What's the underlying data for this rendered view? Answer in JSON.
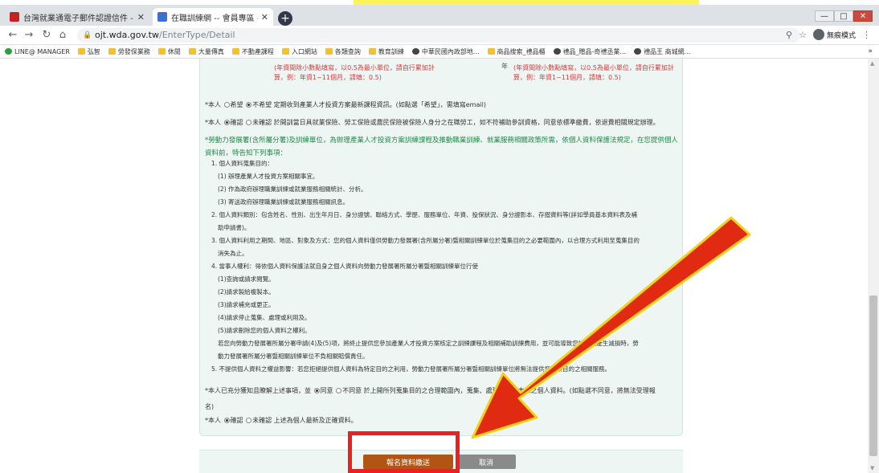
{
  "browser": {
    "tabs": [
      {
        "title": "台灣就業通電子郵件認證信件 - ...",
        "favicon_color": "#c5221f",
        "active": false
      },
      {
        "title": "在職訓練網 -- 會員專區 -- 會員資料",
        "favicon_color": "#3b6fd0",
        "active": true
      }
    ],
    "new_tab": "+",
    "window_controls": [
      "—",
      "□",
      "✕"
    ],
    "address": {
      "host": "ojt.wda.gov.tw",
      "path": "/EnterType/Detail"
    },
    "right_label": "無痕模式",
    "bookmarks": [
      {
        "label": "LINE@ MANAGER",
        "icon": "line-icon"
      },
      {
        "label": "弘智",
        "icon": "folder-icon"
      },
      {
        "label": "勞發保業務",
        "icon": "folder-icon"
      },
      {
        "label": "休閒",
        "icon": "folder-icon"
      },
      {
        "label": "大量傳真",
        "icon": "folder-icon"
      },
      {
        "label": "不動產課程",
        "icon": "folder-icon"
      },
      {
        "label": "入口網站",
        "icon": "folder-icon"
      },
      {
        "label": "各類查詢",
        "icon": "folder-icon"
      },
      {
        "label": "教育訓練",
        "icon": "folder-icon"
      },
      {
        "label": "中華民國內政部地...",
        "icon": "globe-icon"
      },
      {
        "label": "商品搜索_禮品櫃",
        "icon": "folder-icon"
      },
      {
        "label": "禮品_贈品-奇禮丞業...",
        "icon": "globe-icon"
      },
      {
        "label": "禮品王 商城網...",
        "icon": "globe-icon"
      }
    ],
    "bookmarks_more": "»"
  },
  "form": {
    "fee_note_left": "(年資間除小數點填寫，以0.5為最小單位，請自行累加計算，例：年資1~11個月，請填：0.5)",
    "fee_note_right": "(年資間除小數點填寫，以0.5為最小單位，請自行累加計算，例：年資1~11個月，請填：0.5)",
    "fee_mark": "年",
    "subscribe": {
      "prefix": "*本人",
      "opt_yes": "希望",
      "opt_no": "不希望",
      "text": "定期收到產業人才投資方案最新課程資訊。(如點選「希望」，需填寫email)"
    },
    "confirm_identity": {
      "prefix": "*本人",
      "opt_yes": "確認",
      "opt_no": "未確認",
      "text": "於開訓當日具就業保險、勞工保險或農民保險被保險人身分之在職勞工，如不符補助參訓資格，同意依標準繳費，依退費相關規定辦理。"
    },
    "privacy_note": "*勞動力發展署(含所屬分署)及訓練單位，為辦理產業人才投資方案訓練課程及推動職業訓練、就業服務相關政策所需，依個人資料保護法規定，在您提供個人資料前，特告知下列事項：",
    "items": [
      {
        "text": "1. 個人資料蒐集目的："
      },
      {
        "text": "(1) 辦理產業人才投資方案相關事宜。"
      },
      {
        "text": "(2) 作為政府辦理職業訓練或就業服務相關統計、分析。"
      },
      {
        "text": "(3) 寄送政府辦理職業訓練或就業服務相關訊息。"
      },
      {
        "text": "2. 個人資料類別：包含姓名、性別、出生年月日、身分證號、聯絡方式、學歷、服務單位、年資、投保狀況、身分證影本、存摺資料等(詳如學員基本資料表及補"
      },
      {
        "text": "助申請書)。"
      },
      {
        "text": "3. 個人資料利用之期間、地區、對象及方式：您的個人資料僅供勞動力發展署(含所屬分署)暨相關訓練單位於蒐集目的之必要範圍內，以合理方式利用至蒐集目的"
      },
      {
        "text": "消失為止。"
      },
      {
        "text": "4. 當事人權利：得依個人資料保護法就自身之個人資料向勞動力發展署所屬分署暨相關訓練單位行使"
      },
      {
        "text": "(1)查詢或請求閱覽。"
      },
      {
        "text": "(2)請求製給複製本。"
      },
      {
        "text": "(3)請求補充或更正。"
      },
      {
        "text": "(4)請求停止蒐集、處理或利用及。"
      },
      {
        "text": "(5)請求刪除您的個人資料之權利。"
      },
      {
        "text": "若您向勞動力發展署所屬分署申請(4)及(5)項，將終止提供您參加產業人才投資方案核定之訓練課程及相關補助訓練費用，並可能導致您的權益產生減損時，勞"
      },
      {
        "text": "動力發展署所屬分署暨相關訓練單位不負相關賠償責任。"
      },
      {
        "text": "5. 不提供個人資料之權益影響：若您拒絕提供個人資料為特定目的之利用，勞動力發展署所屬分署暨相關訓練單位將無法提供您蒐集目的之相關服務。"
      }
    ],
    "agree": {
      "prefix": "*本人已充分獲知且瞭解上述事項，並",
      "opt_yes": "同意",
      "opt_no": "不同意",
      "text": "於上開所列蒐集目的之合理範圍內，蒐集、處理及利用本人之個人資料。(如點選不同意，將無法受理報",
      "cont": "名)"
    },
    "final_confirm": {
      "prefix": "*本人",
      "opt_yes": "確認",
      "opt_no": "未確認",
      "text": "上述為個人最新及正確資料。"
    },
    "submit_label": "報名資料繳送",
    "cancel_label": "取消"
  },
  "colors": {
    "panel_bg": "#eef6f4",
    "submit_bg": "#b05513",
    "cancel_bg": "#8a8a8a",
    "annotation_red": "#ee1f1f",
    "arrow_fill": "#e02a12",
    "arrow_outline": "#f2d21c",
    "note_green": "#1d8a46",
    "fee_red": "#d43c3c"
  }
}
